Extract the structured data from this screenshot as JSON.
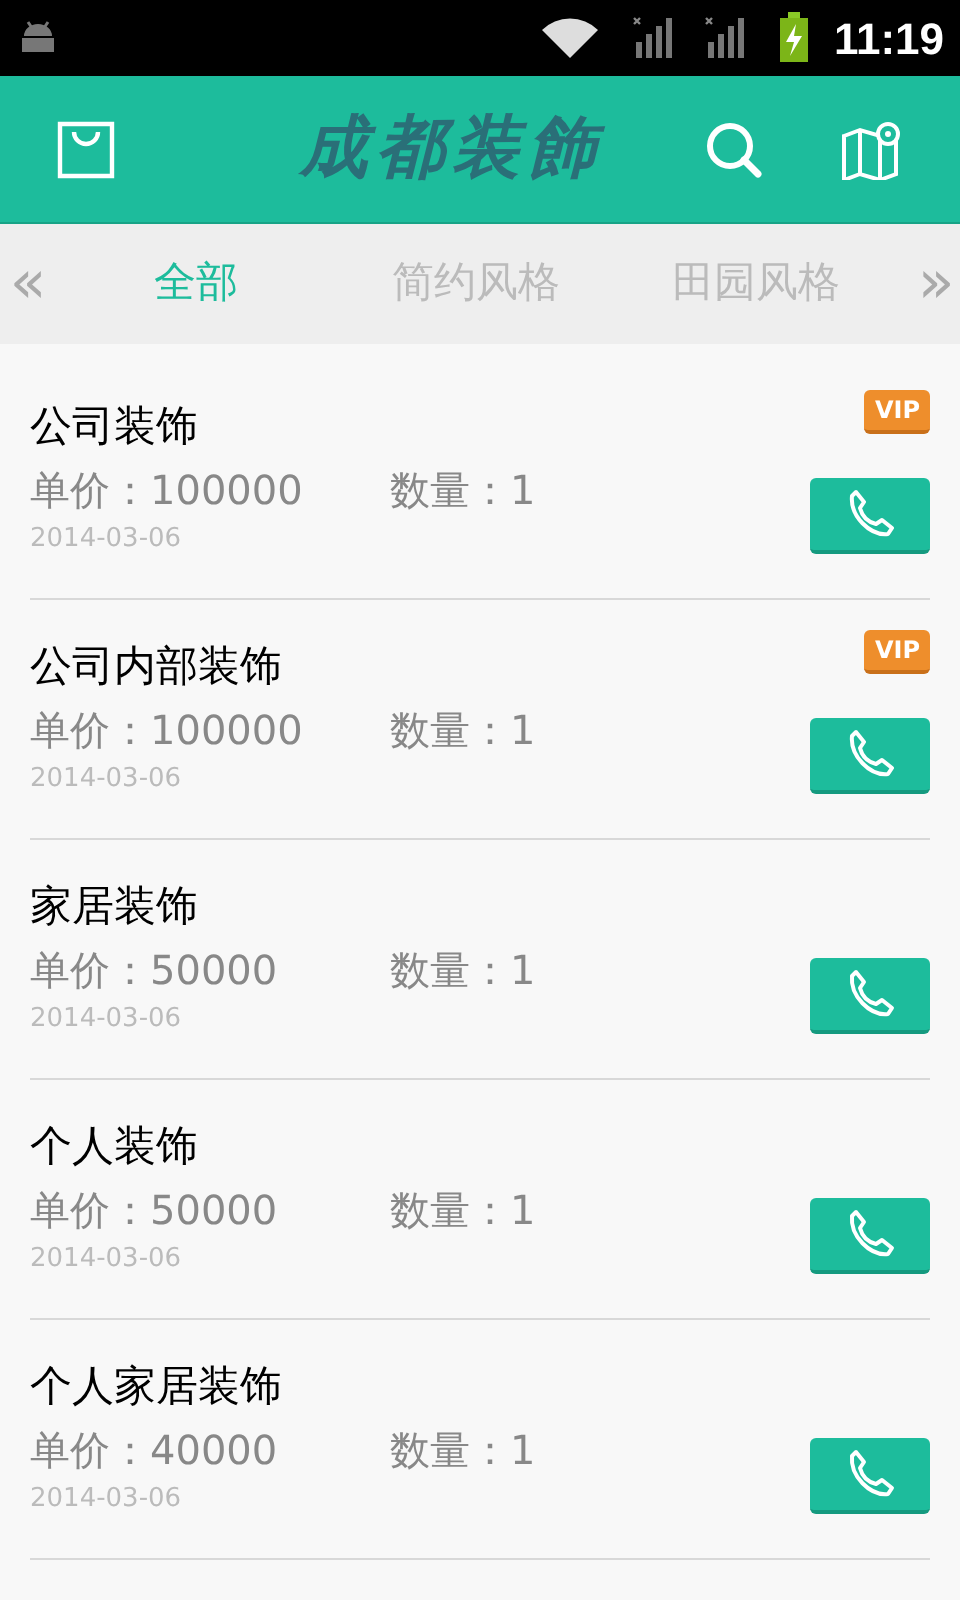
{
  "status_bar": {
    "time": "11:19"
  },
  "header": {
    "title": "成都装飾"
  },
  "tabs": {
    "prev": "«",
    "next": "»",
    "items": [
      {
        "label": "全部",
        "selected": true
      },
      {
        "label": "简约风格",
        "selected": false
      },
      {
        "label": "田园风格",
        "selected": false
      }
    ]
  },
  "items": [
    {
      "title": "公司装饰",
      "price": "单价：100000",
      "quantity": "数量：1",
      "date": "2014-03-06",
      "vip": true,
      "badge": "VIP"
    },
    {
      "title": "公司内部装饰",
      "price": "单价：100000",
      "quantity": "数量：1",
      "date": "2014-03-06",
      "vip": true,
      "badge": "VIP"
    },
    {
      "title": "家居装饰",
      "price": "单价：50000",
      "quantity": "数量：1",
      "date": "2014-03-06",
      "vip": false
    },
    {
      "title": "个人装饰",
      "price": "单价：50000",
      "quantity": "数量：1",
      "date": "2014-03-06",
      "vip": false
    },
    {
      "title": "个人家居装饰",
      "price": "单价：40000",
      "quantity": "数量：1",
      "date": "2014-03-06",
      "vip": false
    }
  ]
}
